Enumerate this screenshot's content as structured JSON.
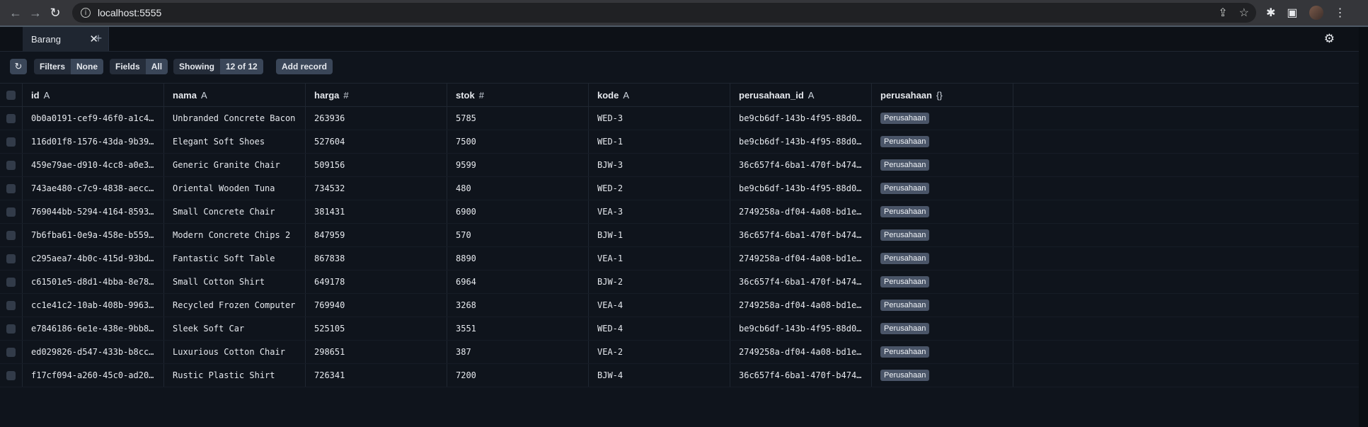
{
  "browser": {
    "url": "localhost:5555"
  },
  "app": {
    "tab_label": "Barang",
    "add_tab_symbol": "+",
    "settings_symbol": "⚙"
  },
  "toolbar": {
    "filters_label": "Filters",
    "filters_value": "None",
    "fields_label": "Fields",
    "fields_value": "All",
    "showing_label": "Showing",
    "showing_value": "12 of 12",
    "add_record_label": "Add record"
  },
  "table": {
    "columns": [
      {
        "name": "id",
        "type": "A"
      },
      {
        "name": "nama",
        "type": "A"
      },
      {
        "name": "harga",
        "type": "#"
      },
      {
        "name": "stok",
        "type": "#"
      },
      {
        "name": "kode",
        "type": "A"
      },
      {
        "name": "perusahaan_id",
        "type": "A"
      },
      {
        "name": "perusahaan",
        "type": "{}"
      }
    ],
    "rows": [
      [
        "0b0a0191-cef9-46f0-a1c4…",
        "Unbranded Concrete Bacon",
        "263936",
        "5785",
        "WED-3",
        "be9cb6df-143b-4f95-88d0…",
        "Perusahaan"
      ],
      [
        "116d01f8-1576-43da-9b39…",
        "Elegant Soft Shoes",
        "527604",
        "7500",
        "WED-1",
        "be9cb6df-143b-4f95-88d0…",
        "Perusahaan"
      ],
      [
        "459e79ae-d910-4cc8-a0e3…",
        "Generic Granite Chair",
        "509156",
        "9599",
        "BJW-3",
        "36c657f4-6ba1-470f-b474…",
        "Perusahaan"
      ],
      [
        "743ae480-c7c9-4838-aecc…",
        "Oriental Wooden Tuna",
        "734532",
        "480",
        "WED-2",
        "be9cb6df-143b-4f95-88d0…",
        "Perusahaan"
      ],
      [
        "769044bb-5294-4164-8593…",
        "Small Concrete Chair",
        "381431",
        "6900",
        "VEA-3",
        "2749258a-df04-4a08-bd1e…",
        "Perusahaan"
      ],
      [
        "7b6fba61-0e9a-458e-b559…",
        "Modern Concrete Chips 2",
        "847959",
        "570",
        "BJW-1",
        "36c657f4-6ba1-470f-b474…",
        "Perusahaan"
      ],
      [
        "c295aea7-4b0c-415d-93bd…",
        "Fantastic Soft Table",
        "867838",
        "8890",
        "VEA-1",
        "2749258a-df04-4a08-bd1e…",
        "Perusahaan"
      ],
      [
        "c61501e5-d8d1-4bba-8e78…",
        "Small Cotton Shirt",
        "649178",
        "6964",
        "BJW-2",
        "36c657f4-6ba1-470f-b474…",
        "Perusahaan"
      ],
      [
        "cc1e41c2-10ab-408b-9963…",
        "Recycled Frozen Computer",
        "769940",
        "3268",
        "VEA-4",
        "2749258a-df04-4a08-bd1e…",
        "Perusahaan"
      ],
      [
        "e7846186-6e1e-438e-9bb8…",
        "Sleek Soft Car",
        "525105",
        "3551",
        "WED-4",
        "be9cb6df-143b-4f95-88d0…",
        "Perusahaan"
      ],
      [
        "ed029826-d547-433b-b8cc…",
        "Luxurious Cotton Chair",
        "298651",
        "387",
        "VEA-2",
        "2749258a-df04-4a08-bd1e…",
        "Perusahaan"
      ],
      [
        "f17cf094-a260-45c0-ad20…",
        "Rustic Plastic Shirt",
        "726341",
        "7200",
        "BJW-4",
        "36c657f4-6ba1-470f-b474…",
        "Perusahaan"
      ]
    ]
  }
}
